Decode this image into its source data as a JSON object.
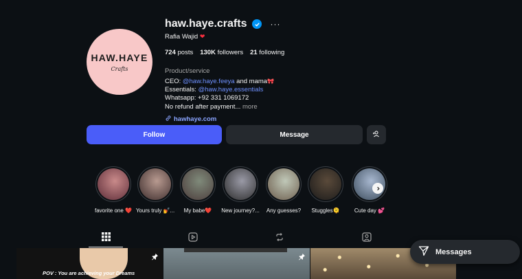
{
  "profile": {
    "username": "haw.haye.crafts",
    "full_name": "Rafia Wajid",
    "name_emoji": "❤",
    "avatar_brand": "HAW.HAYE",
    "avatar_script": "Crafts",
    "stats": {
      "posts_count": "724",
      "posts_label": "posts",
      "followers_count": "130K",
      "followers_label": "followers",
      "following_count": "21",
      "following_label": "following"
    },
    "category": "Product/service",
    "bio": {
      "line1_prefix": "CEO: ",
      "line1_mention": "@haw.haye.feeya",
      "line1_suffix": " and mama",
      "line1_emoji": "🎀",
      "line2_prefix": "Essentials: ",
      "line2_mention": "@haw.haye.essentials",
      "line3": "Whatsapp: +92 331 1069172",
      "line4": "No refund after payment...",
      "more": "more"
    },
    "website": "hawhaye.com"
  },
  "actions": {
    "follow": "Follow",
    "message": "Message"
  },
  "highlights": [
    {
      "label": "favorite one ❤️",
      "colors": [
        "#c98a8a",
        "#5a2a36"
      ]
    },
    {
      "label": "Yours truly 💅...",
      "colors": [
        "#b89a90",
        "#3a2a2a"
      ]
    },
    {
      "label": "My babe❤️",
      "colors": [
        "#7f8a7a",
        "#4a3a3a"
      ]
    },
    {
      "label": "New journey?...",
      "colors": [
        "#9a9aa6",
        "#2a2a2a"
      ]
    },
    {
      "label": "Any guesses?",
      "colors": [
        "#c0c8b8",
        "#6a5a4a"
      ]
    },
    {
      "label": "Stuggles🫠",
      "colors": [
        "#5a4a3a",
        "#1a1a1a"
      ]
    },
    {
      "label": "Cute day 💕",
      "colors": [
        "#a8b8d0",
        "#3a4a5a"
      ]
    }
  ],
  "tabs": [
    {
      "name": "posts",
      "icon": "grid-icon"
    },
    {
      "name": "reels",
      "icon": "reels-icon"
    },
    {
      "name": "reposts",
      "icon": "repost-icon"
    },
    {
      "name": "tagged",
      "icon": "tagged-icon"
    }
  ],
  "posts": [
    {
      "caption": "POV : You are achieving your Dreams",
      "pinned": true
    },
    {
      "caption": "",
      "pinned": true
    },
    {
      "caption": "",
      "pinned": false
    }
  ],
  "messages_pill": {
    "label": "Messages",
    "icon": "paper-plane-icon"
  }
}
